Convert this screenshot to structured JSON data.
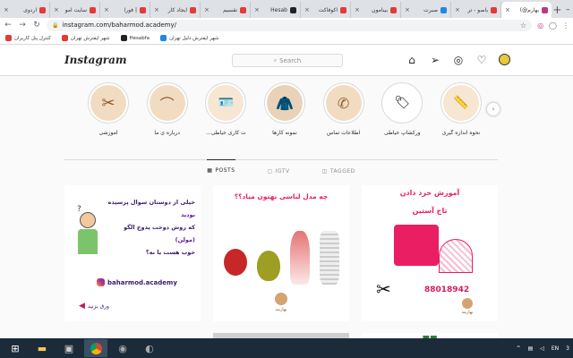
{
  "browser": {
    "tabs": [
      {
        "label": "اردوی",
        "color": "#e53935"
      },
      {
        "label": "سایت آمو",
        "color": "#e53935"
      },
      {
        "label": "فوراً | ",
        "color": "#e53935"
      },
      {
        "label": "ایجاد کار",
        "color": "#e53935"
      },
      {
        "label": "تقسیم",
        "color": "#e53935"
      },
      {
        "label": "Hesab",
        "color": "#222"
      },
      {
        "label": "اکوفاکت",
        "color": "#e53935"
      },
      {
        "label": "بینامون",
        "color": "#e53935"
      },
      {
        "label": "صبرت",
        "color": "#1e88e5"
      },
      {
        "label": "باصو - تر",
        "color": "#e53935"
      },
      {
        "label": "(@بهارم",
        "color": "#c13584",
        "active": true
      }
    ],
    "new_tab": "+",
    "url": "instagram.com/baharmod.academy/",
    "bookmarks": [
      {
        "label": "کنترل پنل کاربران",
        "color": "#e53935"
      },
      {
        "label": "شهر ایفترش تهران",
        "color": "#e53935"
      },
      {
        "label": "Hesabfa",
        "color": "#222"
      },
      {
        "label": "شهر ایفترش دلیل تهران",
        "color": "#1e88e5"
      }
    ]
  },
  "instagram": {
    "logo": "Instagram",
    "search_placeholder": "Search",
    "stories": [
      {
        "label": "نحوه اندازه گیری"
      },
      {
        "label": "ورکشاپ خیاطی"
      },
      {
        "label": "اطلاعات تماس"
      },
      {
        "label": "نمونه کارها"
      },
      {
        "label": "...ت کاری خیاطی"
      },
      {
        "label": "درباره ی ما"
      },
      {
        "label": "آموزشی"
      }
    ],
    "tabs": {
      "posts": "POSTS",
      "igtv": "IGTV",
      "tagged": "TAGGED"
    },
    "posts": [
      {
        "title": "آموزش خرد دادن",
        "subtitle": "تاج آستین",
        "phone": "88018942",
        "brand": "بهارمد"
      },
      {
        "title": "چه مدل لباسی بهتون میاد؟؟",
        "brand": "بهارمد"
      },
      {
        "line1": "خیلی از دوستان سوال پرسیده",
        "line2": "بودید",
        "line3": "که روش دوخت پدوچ الگو",
        "line4": "(مولن)",
        "line5": "خوب هست یا نه؟",
        "handle": "baharmod.academy",
        "swipe": "ورق بزنید"
      }
    ]
  },
  "taskbar": {
    "lang": "EN",
    "clock": "3"
  }
}
